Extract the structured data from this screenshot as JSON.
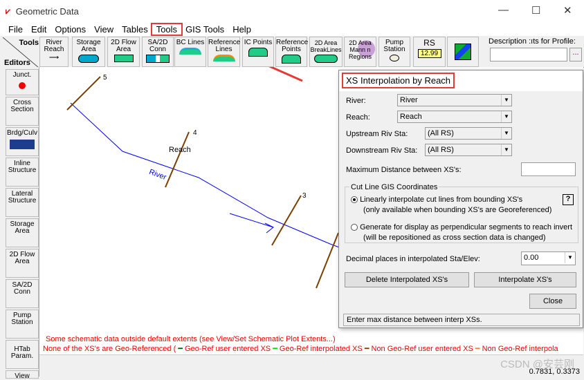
{
  "window": {
    "title": "Geometric Data",
    "min": "—",
    "max": "☐",
    "close": "✕"
  },
  "menu": [
    "File",
    "Edit",
    "Options",
    "View",
    "Tables",
    "Tools",
    "GIS Tools",
    "Help"
  ],
  "toolbar": {
    "tools_label": "Tools",
    "editors_label": "Editors",
    "buttons": [
      "River Reach",
      "Storage Area",
      "2D Flow Area",
      "SA/2D Conn",
      "BC Lines",
      "Reference Lines",
      "IC Points",
      "Reference Points",
      "2D Area BreakLines",
      "2D Area Mann n Regions",
      "Pump Station",
      "RS"
    ],
    "rs_value": "12.99",
    "description_label": "Description :ıts for Profile:",
    "ellipsis": "..."
  },
  "editors": [
    "Junct.",
    "Cross Section",
    "Brdg/Culv",
    "Inline Structure",
    "Lateral Structure",
    "Storage Area",
    "2D Flow Area",
    "SA/2D Conn",
    "Pump Station",
    "HTab Param.",
    "View"
  ],
  "canvas": {
    "xs_labels": [
      "5",
      "4",
      "3"
    ],
    "reach_label": "Reach",
    "river_label": "River",
    "msg1": "Some schematic data outside default extents (see View/Set Schematic Plot Extents...)",
    "legend_prefix": "None of the XS's are Geo-Referenced (",
    "legend": [
      {
        "label": "Geo-Ref user entered XS",
        "color": "#006400"
      },
      {
        "label": "Geo-Ref interpolated XS",
        "color": "#00e000"
      },
      {
        "label": "Non Geo-Ref user entered XS",
        "color": "#7b3f00"
      },
      {
        "label": "Non Geo-Ref interpola",
        "color": "#ff8040"
      }
    ]
  },
  "status": {
    "coords": "0.7831, 0.3373",
    "watermark": "CSDN @安芸刚"
  },
  "dialog": {
    "title": "XS Interpolation by Reach",
    "river_label": "River:",
    "river_value": "River",
    "reach_label": "Reach:",
    "reach_value": "Reach",
    "up_label": "Upstream Riv Sta:",
    "up_value": "(All RS)",
    "down_label": "Downstream Riv Sta:",
    "down_value": "(All RS)",
    "maxdist_label": "Maximum  Distance  between XS's:",
    "maxdist_value": "",
    "group_title": "Cut Line GIS Coordinates",
    "opt1": "Linearly interpolate cut lines from bounding XS's",
    "opt1_sub": "(only available when bounding XS's are Georeferenced)",
    "opt2": "Generate for display as perpendicular segments to reach invert",
    "opt2_sub": "(will be repositioned as cross section data is changed)",
    "help": "?",
    "decimal_label": "Decimal places in interpolated Sta/Elev:",
    "decimal_value": "0.00",
    "delete_btn": "Delete Interpolated  XS's",
    "interp_btn": "Interpolate XS's",
    "close_btn": "Close",
    "status": "Enter max distance between interp XSs."
  }
}
